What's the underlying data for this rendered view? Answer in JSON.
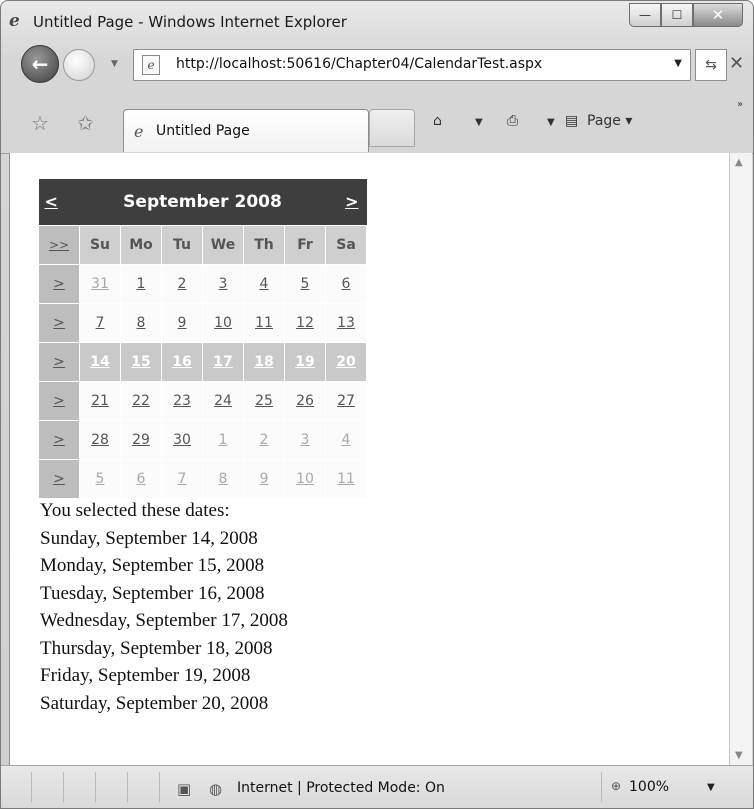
{
  "window": {
    "title": "Untitled Page - Windows Internet Explorer",
    "minimize": "—",
    "maximize": "☐",
    "close": "✕"
  },
  "nav": {
    "url": "http://localhost:50616/Chapter04/CalendarTest.aspx"
  },
  "tab": {
    "label": "Untitled Page"
  },
  "commands": {
    "page": "Page ▾"
  },
  "calendar": {
    "prev": "<",
    "next": ">",
    "title": "September 2008",
    "select_month": ">>",
    "week_select": ">",
    "days_of_week": [
      "Su",
      "Mo",
      "Tu",
      "We",
      "Th",
      "Fr",
      "Sa"
    ],
    "weeks": [
      [
        {
          "d": "31",
          "other": true
        },
        {
          "d": "1"
        },
        {
          "d": "2"
        },
        {
          "d": "3"
        },
        {
          "d": "4"
        },
        {
          "d": "5"
        },
        {
          "d": "6"
        }
      ],
      [
        {
          "d": "7"
        },
        {
          "d": "8"
        },
        {
          "d": "9"
        },
        {
          "d": "10"
        },
        {
          "d": "11"
        },
        {
          "d": "12"
        },
        {
          "d": "13"
        }
      ],
      [
        {
          "d": "14"
        },
        {
          "d": "15"
        },
        {
          "d": "16"
        },
        {
          "d": "17"
        },
        {
          "d": "18"
        },
        {
          "d": "19"
        },
        {
          "d": "20"
        }
      ],
      [
        {
          "d": "21"
        },
        {
          "d": "22"
        },
        {
          "d": "23"
        },
        {
          "d": "24"
        },
        {
          "d": "25"
        },
        {
          "d": "26"
        },
        {
          "d": "27"
        }
      ],
      [
        {
          "d": "28"
        },
        {
          "d": "29"
        },
        {
          "d": "30"
        },
        {
          "d": "1",
          "other": true
        },
        {
          "d": "2",
          "other": true
        },
        {
          "d": "3",
          "other": true
        },
        {
          "d": "4",
          "other": true
        }
      ],
      [
        {
          "d": "5",
          "other": true
        },
        {
          "d": "6",
          "other": true
        },
        {
          "d": "7",
          "other": true
        },
        {
          "d": "8",
          "other": true
        },
        {
          "d": "9",
          "other": true
        },
        {
          "d": "10",
          "other": true
        },
        {
          "d": "11",
          "other": true
        }
      ]
    ],
    "selected_week_index": 2
  },
  "selection": {
    "heading": "You selected these dates:",
    "dates": [
      "Sunday, September 14, 2008",
      "Monday, September 15, 2008",
      "Tuesday, September 16, 2008",
      "Wednesday, September 17, 2008",
      "Thursday, September 18, 2008",
      "Friday, September 19, 2008",
      "Saturday, September 20, 2008"
    ]
  },
  "status": {
    "zone": "Internet | Protected Mode: On",
    "zoom": "100%"
  }
}
